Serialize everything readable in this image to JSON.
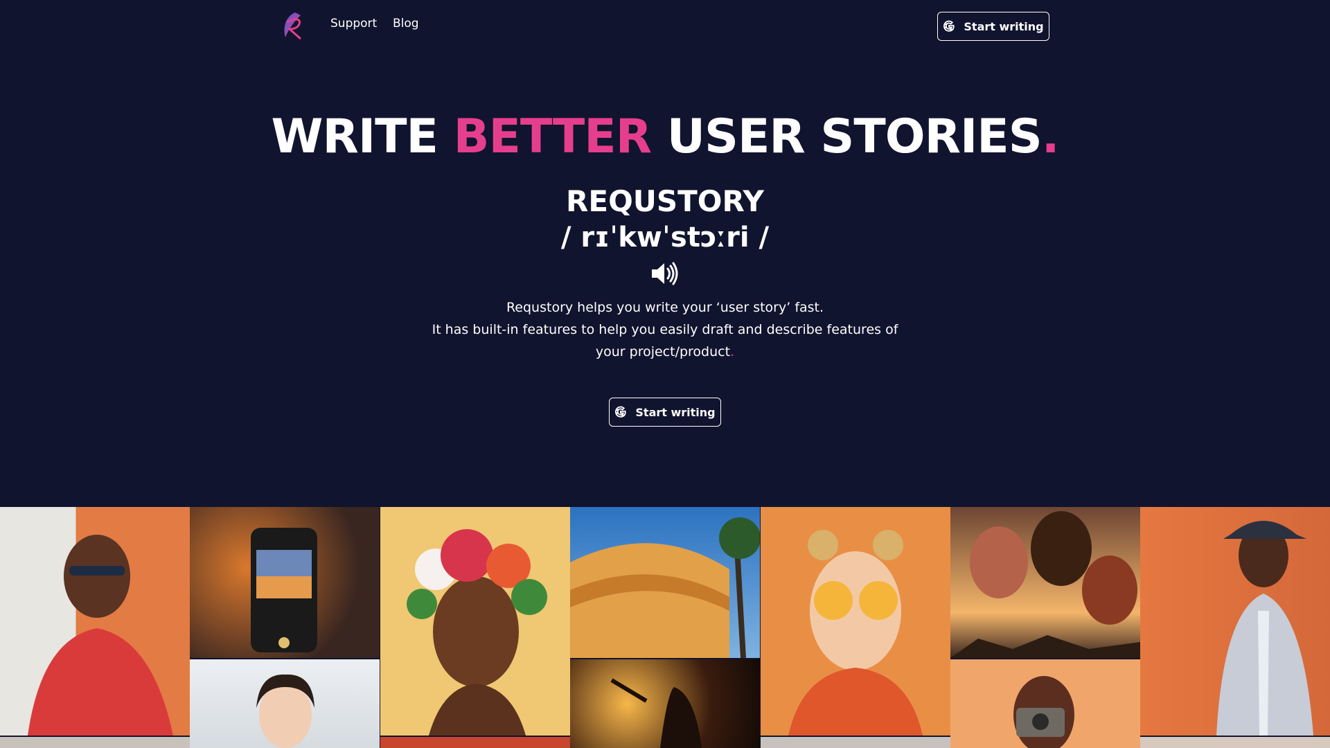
{
  "nav": {
    "links": [
      "Support",
      "Blog"
    ],
    "cta_label": "Start writing"
  },
  "hero": {
    "title_part1": "WRITE ",
    "title_highlight": "BETTER",
    "title_part2": " USER STORIES",
    "title_dot": ".",
    "brand": "REQUSTORY",
    "pronunciation": "/ rɪˈkwˈstɔːri /",
    "description_line1": "Requstory helps you write your ‘user story’ fast.",
    "description_line2": "It has built-in features to help you easily draft and describe features of your project/product",
    "description_dot": ".",
    "cta_label": "Start writing"
  },
  "colors": {
    "background": "#11142e",
    "accent": "#e63e8e"
  },
  "icons": {
    "logo": "feather-logo-icon",
    "google": "google-g-icon",
    "speaker": "speaker-volume-icon"
  },
  "gallery": [
    "man-in-sunglasses-photo",
    "phone-camera-sunset-photo",
    "woman-smiling-photo",
    "woman-flower-crown-photo",
    "building-palm-tree-photo",
    "concert-singer-photo",
    "woman-orange-eyes-photo",
    "hot-air-balloons-photo",
    "woman-camera-photo",
    "man-hat-suit-photo"
  ]
}
